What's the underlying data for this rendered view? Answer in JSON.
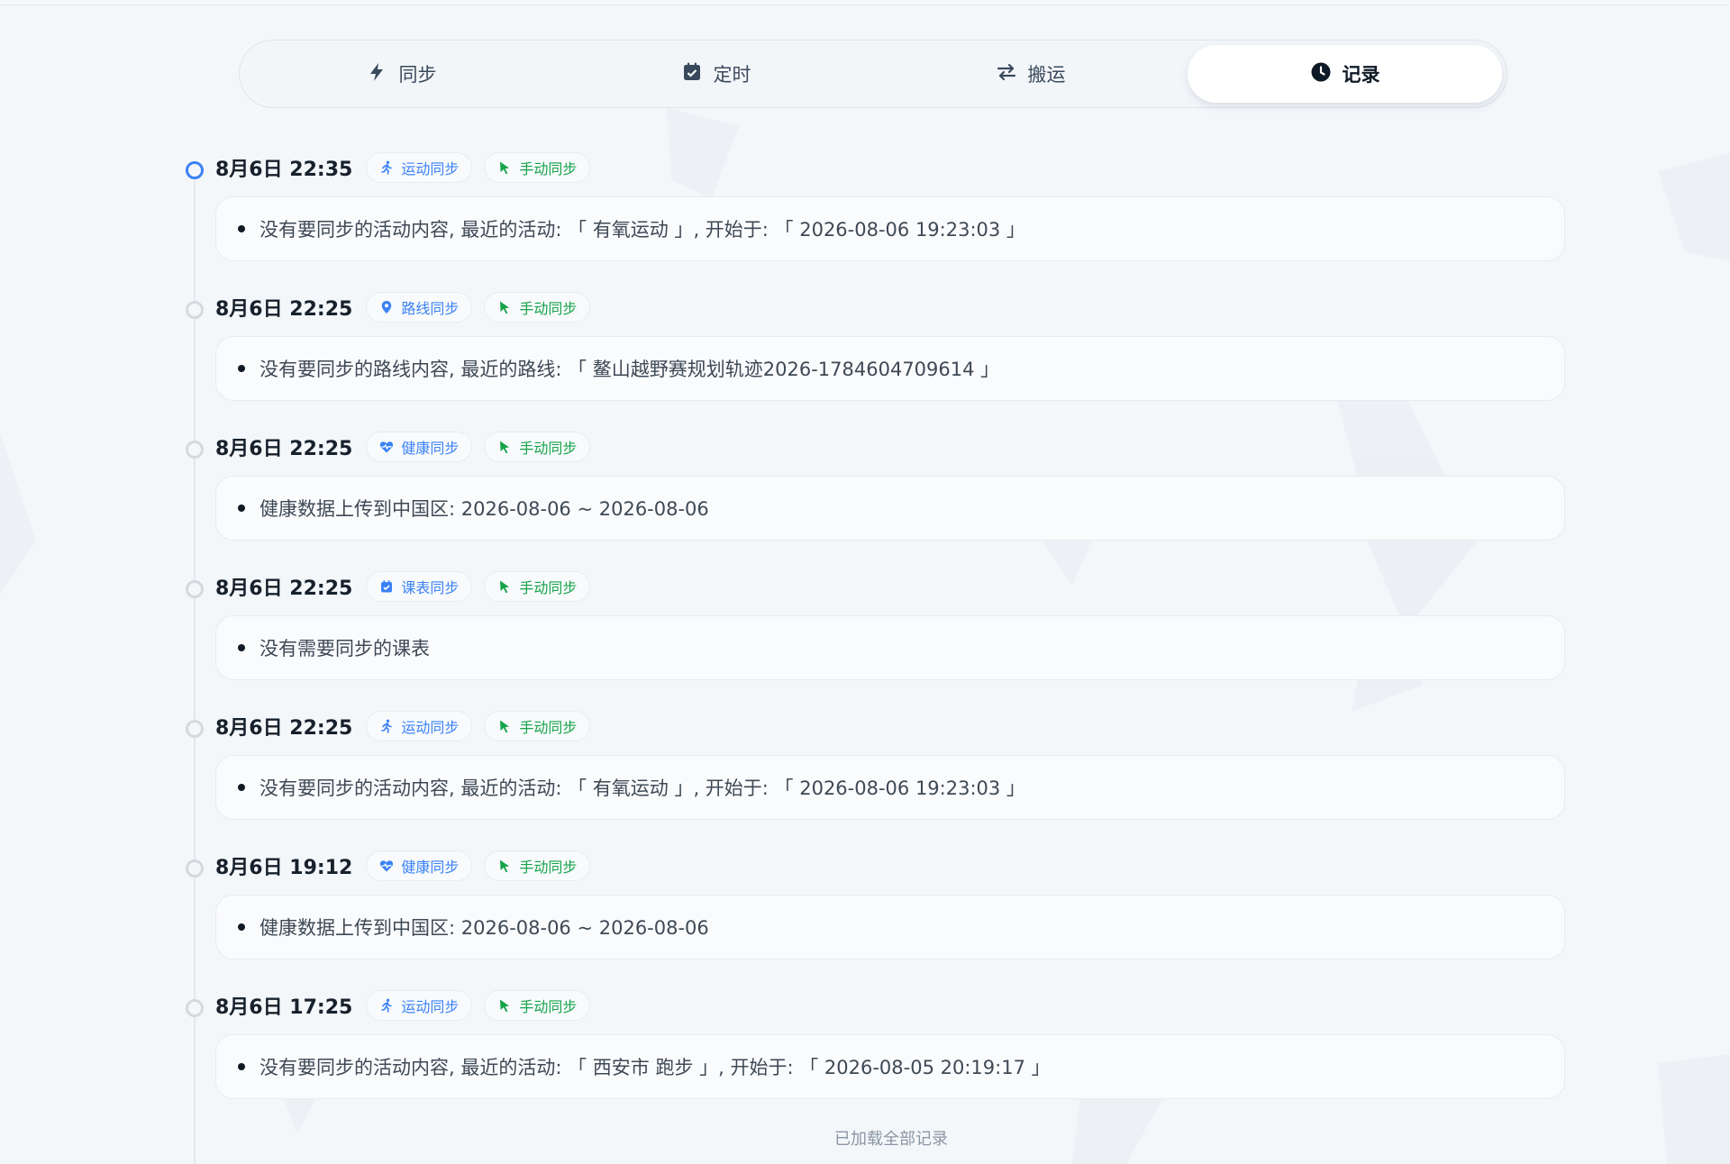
{
  "tabs": [
    {
      "label": "同步",
      "icon": "bolt-icon",
      "active": false
    },
    {
      "label": "定时",
      "icon": "calendar-check-icon",
      "active": false
    },
    {
      "label": "搬运",
      "icon": "arrows-exchange-icon",
      "active": false
    },
    {
      "label": "记录",
      "icon": "clock-icon",
      "active": true
    }
  ],
  "records": [
    {
      "time": "8月6日 22:35",
      "type_label": "运动同步",
      "type_icon": "running-icon",
      "mode_label": "手动同步",
      "mode_icon": "cursor-icon",
      "message": "没有要同步的活动内容, 最近的活动: 「 有氧运动 」, 开始于: 「 2026-08-06 19:23:03 」",
      "current": true
    },
    {
      "time": "8月6日 22:25",
      "type_label": "路线同步",
      "type_icon": "location-pin-icon",
      "mode_label": "手动同步",
      "mode_icon": "cursor-icon",
      "message": "没有要同步的路线内容, 最近的路线: 「 鳌山越野赛规划轨迹2026-1784604709614 」",
      "current": false
    },
    {
      "time": "8月6日 22:25",
      "type_label": "健康同步",
      "type_icon": "heartbeat-icon",
      "mode_label": "手动同步",
      "mode_icon": "cursor-icon",
      "message": "健康数据上传到中国区: 2026-08-06 ~ 2026-08-06",
      "current": false
    },
    {
      "time": "8月6日 22:25",
      "type_label": "课表同步",
      "type_icon": "calendar-check-icon",
      "mode_label": "手动同步",
      "mode_icon": "cursor-icon",
      "message": "没有需要同步的课表",
      "current": false
    },
    {
      "time": "8月6日 22:25",
      "type_label": "运动同步",
      "type_icon": "running-icon",
      "mode_label": "手动同步",
      "mode_icon": "cursor-icon",
      "message": "没有要同步的活动内容, 最近的活动: 「 有氧运动 」, 开始于: 「 2026-08-06 19:23:03 」",
      "current": false
    },
    {
      "time": "8月6日 19:12",
      "type_label": "健康同步",
      "type_icon": "heartbeat-icon",
      "mode_label": "手动同步",
      "mode_icon": "cursor-icon",
      "message": "健康数据上传到中国区: 2026-08-06 ~ 2026-08-06",
      "current": false
    },
    {
      "time": "8月6日 17:25",
      "type_label": "运动同步",
      "type_icon": "running-icon",
      "mode_label": "手动同步",
      "mode_icon": "cursor-icon",
      "message": "没有要同步的活动内容, 最近的活动: 「 西安市 跑步 」, 开始于: 「 2026-08-05 20:19:17 」",
      "current": false
    }
  ],
  "footer": "已加载全部记录",
  "colors": {
    "accent": "#3b82f6",
    "manual": "#16a34a",
    "background": "#f4f7fa"
  }
}
